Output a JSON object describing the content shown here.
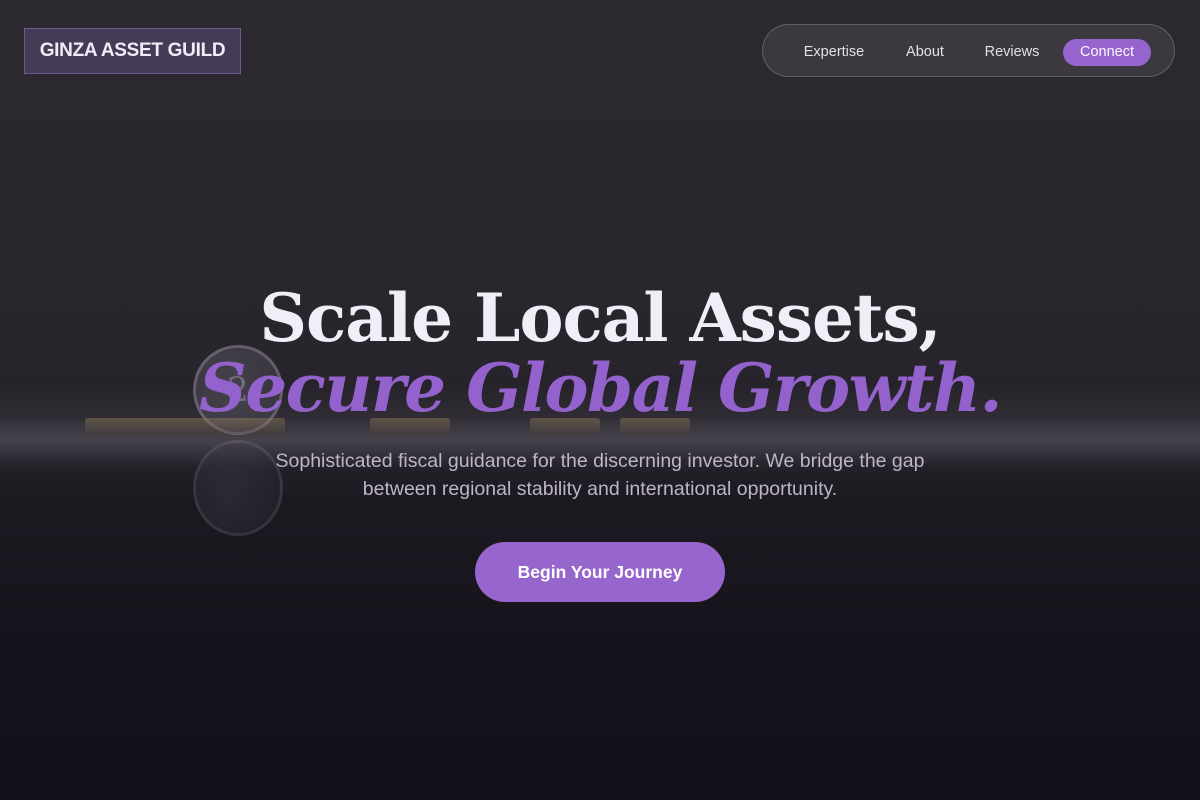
{
  "brand": {
    "logo_text": "GINZA ASSET GUILD"
  },
  "nav": {
    "items": [
      {
        "label": "Expertise"
      },
      {
        "label": "About"
      },
      {
        "label": "Reviews"
      },
      {
        "label": "Connect"
      }
    ]
  },
  "hero": {
    "headline_line1": "Scale Local Assets,",
    "headline_line2": "Secure Global Growth.",
    "subtitle": "Sophisticated fiscal guidance for the discerning investor. We bridge the gap between regional stability and international opportunity.",
    "cta_label": "Begin Your Journey"
  },
  "colors": {
    "accent": "#9564cc",
    "background": "#2b2830",
    "headline": "#f1eef8"
  },
  "decor": {
    "coin_glyph": "2"
  }
}
